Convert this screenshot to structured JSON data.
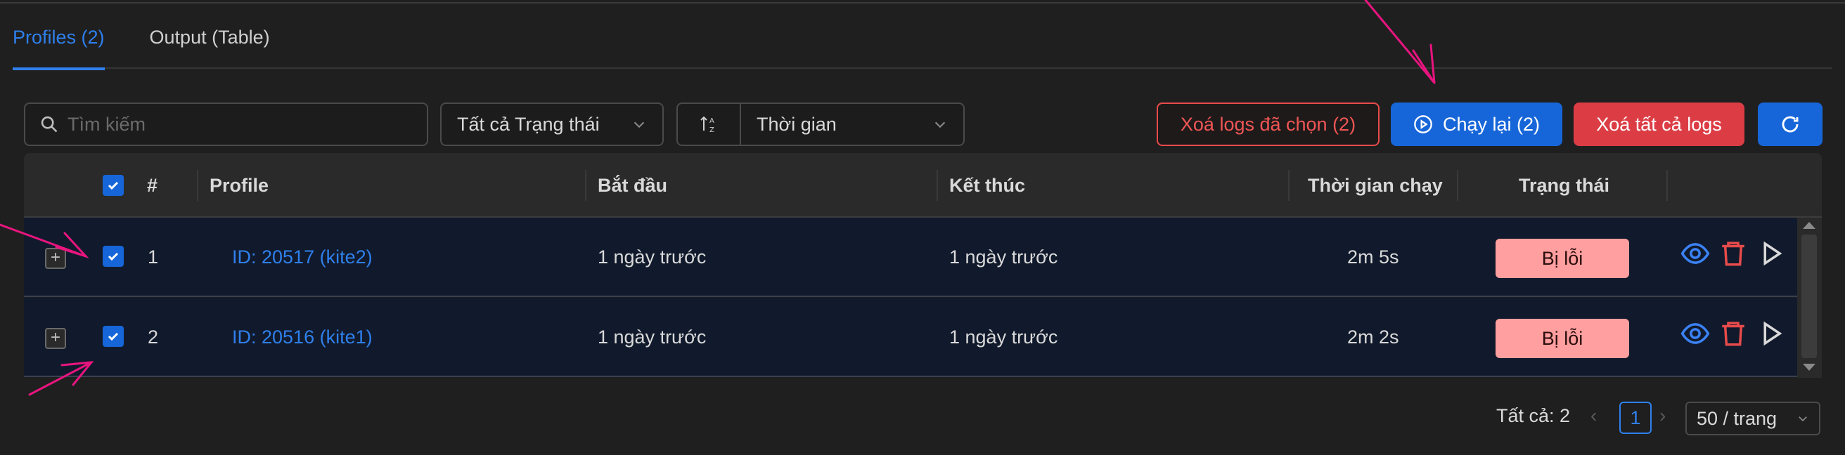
{
  "tabs": [
    {
      "label": "Profiles (2)",
      "active": true
    },
    {
      "label": "Output (Table)",
      "active": false
    }
  ],
  "toolbar": {
    "search_placeholder": "Tìm kiếm",
    "status_filter": "Tất cả Trạng thái",
    "sort_by": "Thời gian",
    "delete_selected_label": "Xoá logs đã chọn (2)",
    "rerun_label": "Chạy lại (2)",
    "delete_all_label": "Xoá tất cả logs"
  },
  "table": {
    "columns": [
      "#",
      "Profile",
      "Bắt đầu",
      "Kết thúc",
      "Thời gian chạy",
      "Trạng thái"
    ],
    "rows": [
      {
        "index": "1",
        "profile": "ID: 20517 (kite2)",
        "start": "1 ngày trước",
        "end": "1 ngày trước",
        "duration": "2m 5s",
        "status": "Bị lỗi",
        "checked": true
      },
      {
        "index": "2",
        "profile": "ID: 20516 (kite1)",
        "start": "1 ngày trước",
        "end": "1 ngày trước",
        "duration": "2m 2s",
        "status": "Bị lỗi",
        "checked": true
      }
    ]
  },
  "pagination": {
    "total_label": "Tất cả: 2",
    "current_page": "1",
    "page_size": "50 / trang"
  },
  "colors": {
    "accent": "#2f80ed",
    "danger": "#dc3d45",
    "error_badge": "#ff9f9f",
    "annotation_arrow": "#e8157f"
  }
}
